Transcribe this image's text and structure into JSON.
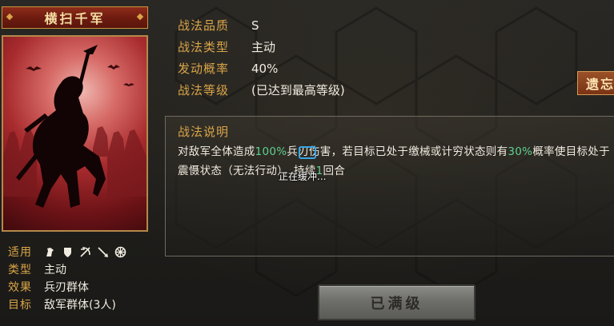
{
  "card": {
    "title": "横扫千军",
    "portrait_icon": "cavalry-silhouette"
  },
  "attributes": {
    "applicable_label": "适用",
    "applicable_units": [
      "cavalry-icon",
      "shield-icon",
      "bow-icon",
      "spear-icon",
      "wheel-icon"
    ],
    "type_label": "类型",
    "type_value": "主动",
    "effect_label": "效果",
    "effect_value": "兵刃群体",
    "target_label": "目标",
    "target_value": "敌军群体(3人)"
  },
  "info": {
    "quality_label": "战法品质",
    "quality_value": "S",
    "type_label": "战法类型",
    "type_value": "主动",
    "rate_label": "发动概率",
    "rate_value": "40%",
    "level_label": "战法等级",
    "level_value": "(已达到最高等级)"
  },
  "side_tab": {
    "label": "遗忘"
  },
  "description": {
    "title": "战法说明",
    "p1": "对敌军全体造成",
    "p1_hl": "100%",
    "p2": "兵刃伤害，若目标已处于缴械或计穷状态则有",
    "p2_hl": "30%",
    "p3": "概率使目标处于震慑状态（无法行动），持续",
    "p3_hl": "1",
    "p4": "回合"
  },
  "overlay": {
    "buffering_text": "正在缓冲..."
  },
  "button": {
    "max_label": "已满级"
  },
  "colors": {
    "gold": "#d9a548",
    "highlight": "#5fd08e",
    "title_bar": "#7a2212"
  }
}
